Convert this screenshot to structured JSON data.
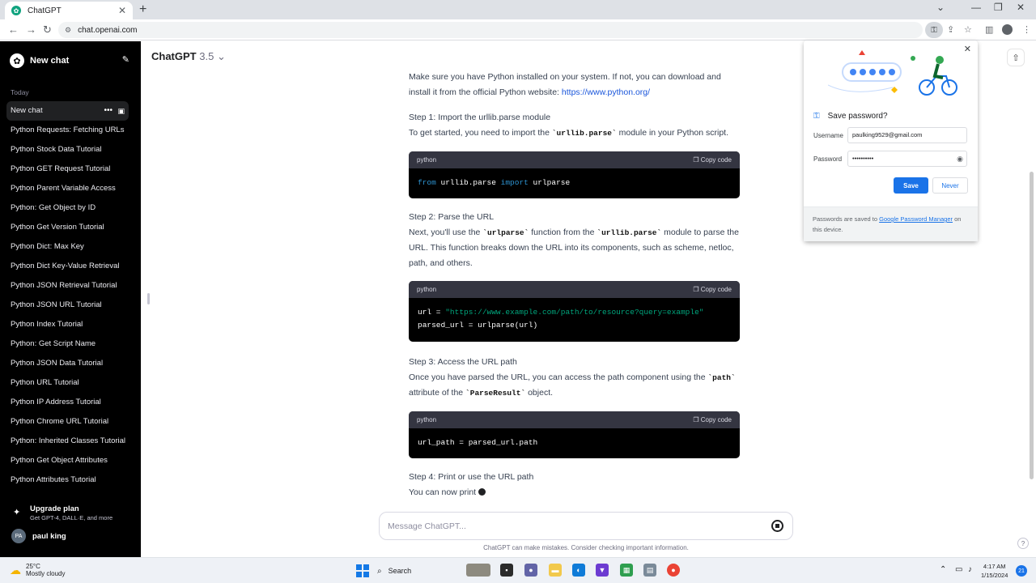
{
  "browser": {
    "tab_title": "ChatGPT",
    "tab_close": "✕",
    "new_tab": "+",
    "url": "chat.openai.com",
    "window_controls": [
      "⌄",
      "—",
      "❐",
      "✕"
    ]
  },
  "sidebar": {
    "new_chat_label": "New chat",
    "section_label": "Today",
    "items": [
      {
        "label": "New chat"
      },
      {
        "label": "Python Requests: Fetching URLs"
      },
      {
        "label": "Python Stock Data Tutorial"
      },
      {
        "label": "Python GET Request Tutorial"
      },
      {
        "label": "Python Parent Variable Access"
      },
      {
        "label": "Python: Get Object by ID"
      },
      {
        "label": "Python Get Version Tutorial"
      },
      {
        "label": "Python Dict: Max Key"
      },
      {
        "label": "Python Dict Key-Value Retrieval"
      },
      {
        "label": "Python JSON Retrieval Tutorial"
      },
      {
        "label": "Python JSON URL Tutorial"
      },
      {
        "label": "Python Index Tutorial"
      },
      {
        "label": "Python: Get Script Name"
      },
      {
        "label": "Python JSON Data Tutorial"
      },
      {
        "label": "Python URL Tutorial"
      },
      {
        "label": "Python IP Address Tutorial"
      },
      {
        "label": "Python Chrome URL Tutorial"
      },
      {
        "label": "Python: Inherited Classes Tutorial"
      },
      {
        "label": "Python Get Object Attributes"
      },
      {
        "label": "Python Attributes Tutorial"
      }
    ],
    "upgrade_title": "Upgrade plan",
    "upgrade_subtitle": "Get GPT-4, DALL·E, and more",
    "user_initials": "PA",
    "user_name": "paul king"
  },
  "main": {
    "model_name": "ChatGPT",
    "model_version": "3.5",
    "intro_text": "Make sure you have Python installed on your system. If not, you can download and install it from the official Python website: ",
    "intro_link": "https://www.python.org/",
    "step1_heading": "Step 1: Import the urllib.parse module",
    "step1_pre": "To get started, you need to import the ",
    "step1_code": "`urllib.parse`",
    "step1_post": " module in your Python script.",
    "code_lang": "python",
    "copy_label": "Copy code",
    "code1": {
      "kw1": "from",
      "mod": " urllib.parse ",
      "kw2": "import",
      "name": " urlparse"
    },
    "step2_heading": "Step 2: Parse the URL",
    "step2_a": "Next, you'll use the ",
    "step2_code1": "`urlparse`",
    "step2_b": " function from the ",
    "step2_code2": "`urllib.parse`",
    "step2_c": " module to parse the URL. This function breaks down the URL into its components, such as scheme, netloc, path, and others.",
    "code2": {
      "line1_var": "url = ",
      "line1_str": "\"https://www.example.com/path/to/resource?query=example\"",
      "line2": "parsed_url = urlparse(url)"
    },
    "step3_heading": "Step 3: Access the URL path",
    "step3_a": "Once you have parsed the URL, you can access the path component using the ",
    "step3_code1": "`path`",
    "step3_b": " attribute of the ",
    "step3_code2": "`ParseResult`",
    "step3_c": " object.",
    "code3": "url_path = parsed_url.path",
    "step4_heading": "Step 4: Print or use the URL path",
    "step4_text": "You can now print",
    "composer_placeholder": "Message ChatGPT...",
    "disclaimer": "ChatGPT can make mistakes. Consider checking important information.",
    "help": "?"
  },
  "password_popup": {
    "title": "Save password?",
    "username_label": "Username",
    "username_value": "paulking9529@gmail.com",
    "password_label": "Password",
    "password_value": "••••••••••",
    "save_label": "Save",
    "never_label": "Never",
    "footer_pre": "Passwords are saved to ",
    "footer_link": "Google Password Manager",
    "footer_post": " on this device."
  },
  "taskbar": {
    "weather_temp": "25°C",
    "weather_desc": "Mostly cloudy",
    "search_label": "Search",
    "time": "4:17 AM",
    "date": "1/15/2024",
    "notif_count": "21"
  },
  "colors": {
    "sidebar_bg": "#000000",
    "accent_blue": "#1a73e8",
    "code_bg": "#000000",
    "code_header": "#343541"
  }
}
